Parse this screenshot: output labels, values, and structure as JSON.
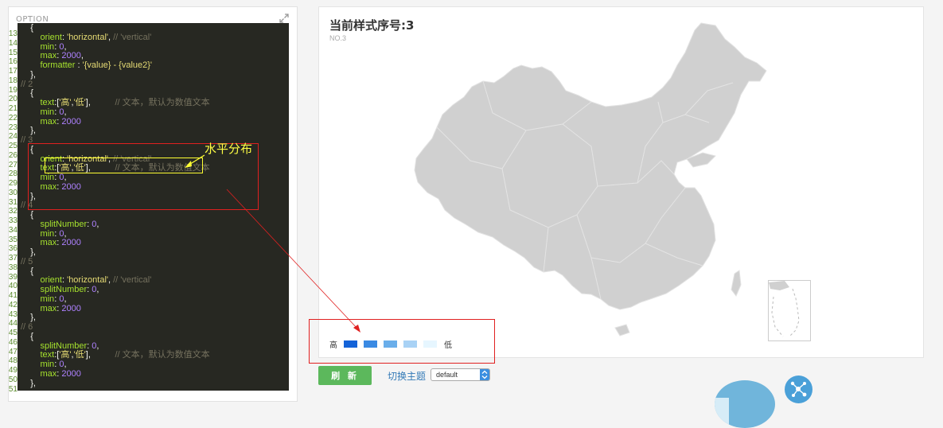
{
  "editor": {
    "title": "OPTION",
    "lines": [
      {
        "n": "13",
        "tokens": [
          [
            "p",
            "    {"
          ]
        ]
      },
      {
        "n": "14",
        "tokens": [
          [
            "key",
            "        orient"
          ],
          [
            "p",
            ": "
          ],
          [
            "str",
            "'horizontal'"
          ],
          [
            "p",
            ", "
          ],
          [
            "c",
            "// 'vertical'"
          ]
        ]
      },
      {
        "n": "15",
        "tokens": [
          [
            "key",
            "        min"
          ],
          [
            "p",
            ": "
          ],
          [
            "num",
            "0"
          ],
          [
            "p",
            ","
          ]
        ]
      },
      {
        "n": "16",
        "tokens": [
          [
            "key",
            "        max"
          ],
          [
            "p",
            ": "
          ],
          [
            "num",
            "2000"
          ],
          [
            "p",
            ","
          ]
        ]
      },
      {
        "n": "17",
        "tokens": [
          [
            "key",
            "        formatter"
          ],
          [
            "p",
            " : "
          ],
          [
            "str",
            "'{value} - {value2}'"
          ]
        ]
      },
      {
        "n": "18",
        "tokens": [
          [
            "p",
            "    },"
          ]
        ]
      },
      {
        "n": "19",
        "tokens": [
          [
            "c",
            "// 2"
          ]
        ]
      },
      {
        "n": "20",
        "tokens": [
          [
            "p",
            "    {"
          ]
        ]
      },
      {
        "n": "21",
        "tokens": [
          [
            "key",
            "        text"
          ],
          [
            "p",
            ":["
          ],
          [
            "str",
            "'高'"
          ],
          [
            "p",
            ","
          ],
          [
            "str",
            "'低'"
          ],
          [
            "p",
            "],          "
          ],
          [
            "c",
            "// 文本，默认为数值文本"
          ]
        ]
      },
      {
        "n": "22",
        "tokens": [
          [
            "key",
            "        min"
          ],
          [
            "p",
            ": "
          ],
          [
            "num",
            "0"
          ],
          [
            "p",
            ","
          ]
        ]
      },
      {
        "n": "23",
        "tokens": [
          [
            "key",
            "        max"
          ],
          [
            "p",
            ": "
          ],
          [
            "num",
            "2000"
          ]
        ]
      },
      {
        "n": "24",
        "tokens": [
          [
            "p",
            "    },"
          ]
        ]
      },
      {
        "n": "25",
        "tokens": [
          [
            "c",
            "// 3"
          ]
        ]
      },
      {
        "n": "26",
        "tokens": [
          [
            "p",
            "    {"
          ]
        ]
      },
      {
        "n": "27",
        "tokens": [
          [
            "key",
            "        orient"
          ],
          [
            "p",
            ": "
          ],
          [
            "str",
            "'horizontal'"
          ],
          [
            "p",
            ", "
          ],
          [
            "c",
            "// 'vertical'"
          ]
        ]
      },
      {
        "n": "28",
        "tokens": [
          [
            "key",
            "        text"
          ],
          [
            "p",
            ":["
          ],
          [
            "str",
            "'高'"
          ],
          [
            "p",
            ","
          ],
          [
            "str",
            "'低'"
          ],
          [
            "p",
            "],          "
          ],
          [
            "c",
            "// 文本，默认为数值文本"
          ]
        ]
      },
      {
        "n": "29",
        "tokens": [
          [
            "key",
            "        min"
          ],
          [
            "p",
            ": "
          ],
          [
            "num",
            "0"
          ],
          [
            "p",
            ","
          ]
        ]
      },
      {
        "n": "30",
        "tokens": [
          [
            "key",
            "        max"
          ],
          [
            "p",
            ": "
          ],
          [
            "num",
            "2000"
          ]
        ]
      },
      {
        "n": "31",
        "tokens": [
          [
            "p",
            "    },"
          ]
        ]
      },
      {
        "n": "32",
        "tokens": [
          [
            "c",
            "// 4"
          ]
        ]
      },
      {
        "n": "33",
        "tokens": [
          [
            "p",
            "    {"
          ]
        ]
      },
      {
        "n": "34",
        "tokens": [
          [
            "key",
            "        splitNumber"
          ],
          [
            "p",
            ": "
          ],
          [
            "num",
            "0"
          ],
          [
            "p",
            ","
          ]
        ]
      },
      {
        "n": "35",
        "tokens": [
          [
            "key",
            "        min"
          ],
          [
            "p",
            ": "
          ],
          [
            "num",
            "0"
          ],
          [
            "p",
            ","
          ]
        ]
      },
      {
        "n": "36",
        "tokens": [
          [
            "key",
            "        max"
          ],
          [
            "p",
            ": "
          ],
          [
            "num",
            "2000"
          ]
        ]
      },
      {
        "n": "37",
        "tokens": [
          [
            "p",
            "    },"
          ]
        ]
      },
      {
        "n": "38",
        "tokens": [
          [
            "c",
            "// 5"
          ]
        ]
      },
      {
        "n": "39",
        "tokens": [
          [
            "p",
            "    {"
          ]
        ]
      },
      {
        "n": "40",
        "tokens": [
          [
            "key",
            "        orient"
          ],
          [
            "p",
            ": "
          ],
          [
            "str",
            "'horizontal'"
          ],
          [
            "p",
            ", "
          ],
          [
            "c",
            "// 'vertical'"
          ]
        ]
      },
      {
        "n": "41",
        "tokens": [
          [
            "key",
            "        splitNumber"
          ],
          [
            "p",
            ": "
          ],
          [
            "num",
            "0"
          ],
          [
            "p",
            ","
          ]
        ]
      },
      {
        "n": "42",
        "tokens": [
          [
            "key",
            "        min"
          ],
          [
            "p",
            ": "
          ],
          [
            "num",
            "0"
          ],
          [
            "p",
            ","
          ]
        ]
      },
      {
        "n": "43",
        "tokens": [
          [
            "key",
            "        max"
          ],
          [
            "p",
            ": "
          ],
          [
            "num",
            "2000"
          ]
        ]
      },
      {
        "n": "44",
        "tokens": [
          [
            "p",
            "    },"
          ]
        ]
      },
      {
        "n": "45",
        "tokens": [
          [
            "c",
            "// 6"
          ]
        ]
      },
      {
        "n": "46",
        "tokens": [
          [
            "p",
            "    {"
          ]
        ]
      },
      {
        "n": "47",
        "tokens": [
          [
            "key",
            "        splitNumber"
          ],
          [
            "p",
            ": "
          ],
          [
            "num",
            "0"
          ],
          [
            "p",
            ","
          ]
        ]
      },
      {
        "n": "48",
        "tokens": [
          [
            "key",
            "        text"
          ],
          [
            "p",
            ":["
          ],
          [
            "str",
            "'高'"
          ],
          [
            "p",
            ","
          ],
          [
            "str",
            "'低'"
          ],
          [
            "p",
            "],          "
          ],
          [
            "c",
            "// 文本，默认为数值文本"
          ]
        ]
      },
      {
        "n": "49",
        "tokens": [
          [
            "key",
            "        min"
          ],
          [
            "p",
            ": "
          ],
          [
            "num",
            "0"
          ],
          [
            "p",
            ","
          ]
        ]
      },
      {
        "n": "50",
        "tokens": [
          [
            "key",
            "        max"
          ],
          [
            "p",
            ": "
          ],
          [
            "num",
            "2000"
          ]
        ]
      },
      {
        "n": "51",
        "tokens": [
          [
            "p",
            "    },"
          ]
        ]
      }
    ]
  },
  "annotation": {
    "note": "水平分布"
  },
  "map": {
    "title": "当前样式序号:3",
    "subtitle": "NO.3",
    "legend": {
      "high": "高",
      "low": "低",
      "colors": [
        "#1463d8",
        "#3a8ae3",
        "#6aaeea",
        "#a9d2f5",
        "#e6f6ff"
      ]
    }
  },
  "controls": {
    "refresh_label": "刷 新",
    "theme_label": "切换主题",
    "theme_value": "default"
  },
  "colors": {
    "map_fill": "#d0d0d0",
    "refresh_button": "#5cb85c",
    "annotation_red": "#e02020",
    "annotation_yellow": "#ffff33"
  }
}
